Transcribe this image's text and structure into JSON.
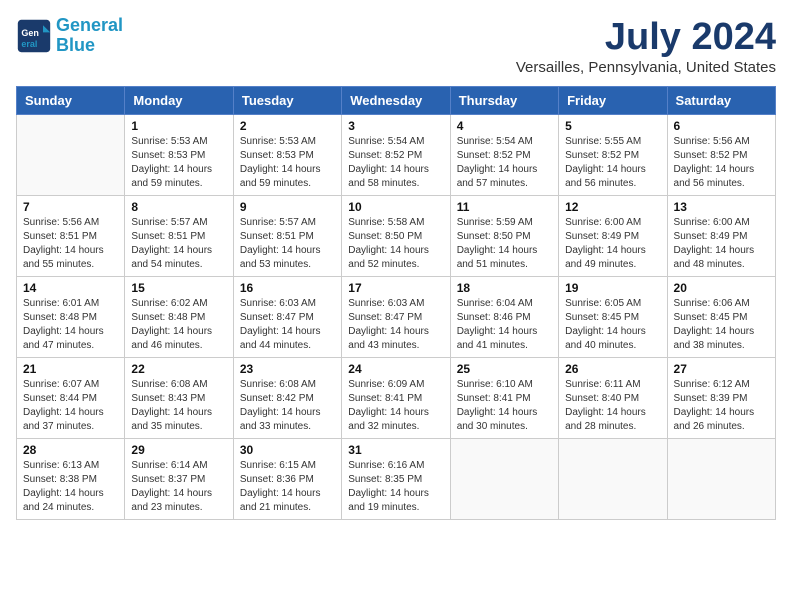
{
  "header": {
    "logo_line1": "General",
    "logo_line2": "Blue",
    "month_title": "July 2024",
    "location": "Versailles, Pennsylvania, United States"
  },
  "weekdays": [
    "Sunday",
    "Monday",
    "Tuesday",
    "Wednesday",
    "Thursday",
    "Friday",
    "Saturday"
  ],
  "weeks": [
    [
      {
        "day": "",
        "sunrise": "",
        "sunset": "",
        "daylight": ""
      },
      {
        "day": "1",
        "sunrise": "Sunrise: 5:53 AM",
        "sunset": "Sunset: 8:53 PM",
        "daylight": "Daylight: 14 hours and 59 minutes."
      },
      {
        "day": "2",
        "sunrise": "Sunrise: 5:53 AM",
        "sunset": "Sunset: 8:53 PM",
        "daylight": "Daylight: 14 hours and 59 minutes."
      },
      {
        "day": "3",
        "sunrise": "Sunrise: 5:54 AM",
        "sunset": "Sunset: 8:52 PM",
        "daylight": "Daylight: 14 hours and 58 minutes."
      },
      {
        "day": "4",
        "sunrise": "Sunrise: 5:54 AM",
        "sunset": "Sunset: 8:52 PM",
        "daylight": "Daylight: 14 hours and 57 minutes."
      },
      {
        "day": "5",
        "sunrise": "Sunrise: 5:55 AM",
        "sunset": "Sunset: 8:52 PM",
        "daylight": "Daylight: 14 hours and 56 minutes."
      },
      {
        "day": "6",
        "sunrise": "Sunrise: 5:56 AM",
        "sunset": "Sunset: 8:52 PM",
        "daylight": "Daylight: 14 hours and 56 minutes."
      }
    ],
    [
      {
        "day": "7",
        "sunrise": "Sunrise: 5:56 AM",
        "sunset": "Sunset: 8:51 PM",
        "daylight": "Daylight: 14 hours and 55 minutes."
      },
      {
        "day": "8",
        "sunrise": "Sunrise: 5:57 AM",
        "sunset": "Sunset: 8:51 PM",
        "daylight": "Daylight: 14 hours and 54 minutes."
      },
      {
        "day": "9",
        "sunrise": "Sunrise: 5:57 AM",
        "sunset": "Sunset: 8:51 PM",
        "daylight": "Daylight: 14 hours and 53 minutes."
      },
      {
        "day": "10",
        "sunrise": "Sunrise: 5:58 AM",
        "sunset": "Sunset: 8:50 PM",
        "daylight": "Daylight: 14 hours and 52 minutes."
      },
      {
        "day": "11",
        "sunrise": "Sunrise: 5:59 AM",
        "sunset": "Sunset: 8:50 PM",
        "daylight": "Daylight: 14 hours and 51 minutes."
      },
      {
        "day": "12",
        "sunrise": "Sunrise: 6:00 AM",
        "sunset": "Sunset: 8:49 PM",
        "daylight": "Daylight: 14 hours and 49 minutes."
      },
      {
        "day": "13",
        "sunrise": "Sunrise: 6:00 AM",
        "sunset": "Sunset: 8:49 PM",
        "daylight": "Daylight: 14 hours and 48 minutes."
      }
    ],
    [
      {
        "day": "14",
        "sunrise": "Sunrise: 6:01 AM",
        "sunset": "Sunset: 8:48 PM",
        "daylight": "Daylight: 14 hours and 47 minutes."
      },
      {
        "day": "15",
        "sunrise": "Sunrise: 6:02 AM",
        "sunset": "Sunset: 8:48 PM",
        "daylight": "Daylight: 14 hours and 46 minutes."
      },
      {
        "day": "16",
        "sunrise": "Sunrise: 6:03 AM",
        "sunset": "Sunset: 8:47 PM",
        "daylight": "Daylight: 14 hours and 44 minutes."
      },
      {
        "day": "17",
        "sunrise": "Sunrise: 6:03 AM",
        "sunset": "Sunset: 8:47 PM",
        "daylight": "Daylight: 14 hours and 43 minutes."
      },
      {
        "day": "18",
        "sunrise": "Sunrise: 6:04 AM",
        "sunset": "Sunset: 8:46 PM",
        "daylight": "Daylight: 14 hours and 41 minutes."
      },
      {
        "day": "19",
        "sunrise": "Sunrise: 6:05 AM",
        "sunset": "Sunset: 8:45 PM",
        "daylight": "Daylight: 14 hours and 40 minutes."
      },
      {
        "day": "20",
        "sunrise": "Sunrise: 6:06 AM",
        "sunset": "Sunset: 8:45 PM",
        "daylight": "Daylight: 14 hours and 38 minutes."
      }
    ],
    [
      {
        "day": "21",
        "sunrise": "Sunrise: 6:07 AM",
        "sunset": "Sunset: 8:44 PM",
        "daylight": "Daylight: 14 hours and 37 minutes."
      },
      {
        "day": "22",
        "sunrise": "Sunrise: 6:08 AM",
        "sunset": "Sunset: 8:43 PM",
        "daylight": "Daylight: 14 hours and 35 minutes."
      },
      {
        "day": "23",
        "sunrise": "Sunrise: 6:08 AM",
        "sunset": "Sunset: 8:42 PM",
        "daylight": "Daylight: 14 hours and 33 minutes."
      },
      {
        "day": "24",
        "sunrise": "Sunrise: 6:09 AM",
        "sunset": "Sunset: 8:41 PM",
        "daylight": "Daylight: 14 hours and 32 minutes."
      },
      {
        "day": "25",
        "sunrise": "Sunrise: 6:10 AM",
        "sunset": "Sunset: 8:41 PM",
        "daylight": "Daylight: 14 hours and 30 minutes."
      },
      {
        "day": "26",
        "sunrise": "Sunrise: 6:11 AM",
        "sunset": "Sunset: 8:40 PM",
        "daylight": "Daylight: 14 hours and 28 minutes."
      },
      {
        "day": "27",
        "sunrise": "Sunrise: 6:12 AM",
        "sunset": "Sunset: 8:39 PM",
        "daylight": "Daylight: 14 hours and 26 minutes."
      }
    ],
    [
      {
        "day": "28",
        "sunrise": "Sunrise: 6:13 AM",
        "sunset": "Sunset: 8:38 PM",
        "daylight": "Daylight: 14 hours and 24 minutes."
      },
      {
        "day": "29",
        "sunrise": "Sunrise: 6:14 AM",
        "sunset": "Sunset: 8:37 PM",
        "daylight": "Daylight: 14 hours and 23 minutes."
      },
      {
        "day": "30",
        "sunrise": "Sunrise: 6:15 AM",
        "sunset": "Sunset: 8:36 PM",
        "daylight": "Daylight: 14 hours and 21 minutes."
      },
      {
        "day": "31",
        "sunrise": "Sunrise: 6:16 AM",
        "sunset": "Sunset: 8:35 PM",
        "daylight": "Daylight: 14 hours and 19 minutes."
      },
      {
        "day": "",
        "sunrise": "",
        "sunset": "",
        "daylight": ""
      },
      {
        "day": "",
        "sunrise": "",
        "sunset": "",
        "daylight": ""
      },
      {
        "day": "",
        "sunrise": "",
        "sunset": "",
        "daylight": ""
      }
    ]
  ]
}
